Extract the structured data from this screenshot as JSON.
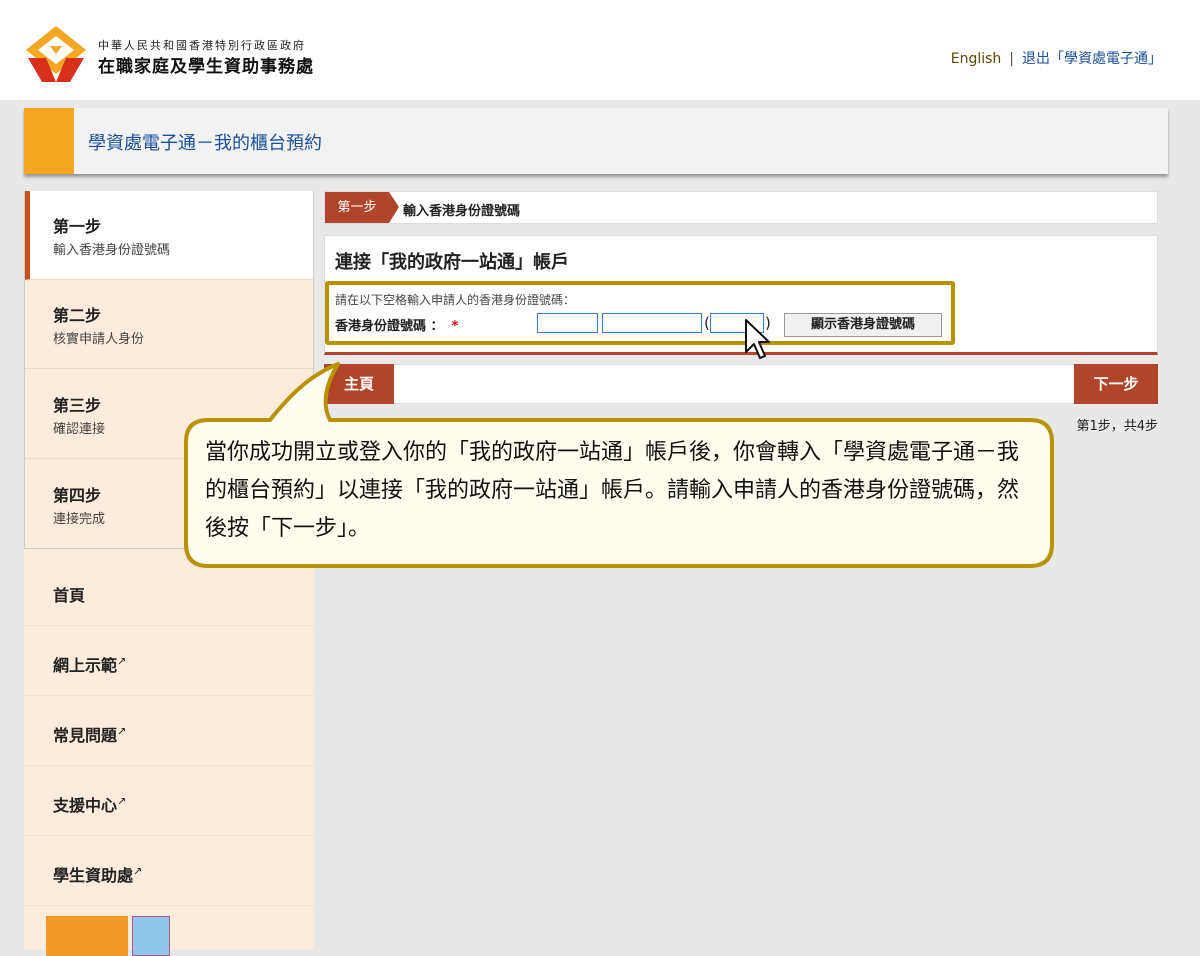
{
  "header": {
    "org_sub": "中華人民共和國香港特別行政區政府",
    "org_main": "在職家庭及學生資助事務處",
    "english_link": "English",
    "separator": "|",
    "logout_link": "退出「學資處電子通」"
  },
  "page_title": "學資處電子通－我的櫃台預約",
  "steps": [
    {
      "title": "第一步",
      "subtitle": "輸入香港身份證號碼",
      "active": true
    },
    {
      "title": "第二步",
      "subtitle": "核實申請人身份",
      "active": false
    },
    {
      "title": "第三步",
      "subtitle": "確認連接",
      "active": false
    },
    {
      "title": "第四步",
      "subtitle": "連接完成",
      "active": false
    }
  ],
  "nav": [
    {
      "label": "首頁",
      "external": false
    },
    {
      "label": "網上示範",
      "external": true
    },
    {
      "label": "常見問題",
      "external": true
    },
    {
      "label": "支援中心",
      "external": true
    },
    {
      "label": "學生資助處",
      "external": true
    }
  ],
  "breadcrumb": {
    "tag": "第一步",
    "text": "輸入香港身份證號碼"
  },
  "form": {
    "heading": "連接「我的政府一站通」帳戶",
    "prompt": "請在以下空格輸入申請人的香港身份證號碼：",
    "field_label": "香港身份證號碼 ：",
    "required_mark": "*",
    "id_part1": "",
    "id_part2": "",
    "id_check": "",
    "paren_open": "(",
    "paren_close": ")",
    "show_button": "顯示香港身證號碼"
  },
  "buttons": {
    "home": "主頁",
    "next": "下一步"
  },
  "step_count": "第1步，共4步",
  "callout": "當你成功開立或登入你的「我的政府一站通」帳戶後，你會轉入「學資處電子通－我的櫃台預約」以連接「我的政府一站通」帳戶。請輸入申請人的香港身份證號碼，然後按「下一步」。",
  "colors": {
    "accent_orange": "#f5a623",
    "brand_red": "#b0452a",
    "highlight_gold": "#b89200",
    "link_blue": "#1a4f9c"
  }
}
